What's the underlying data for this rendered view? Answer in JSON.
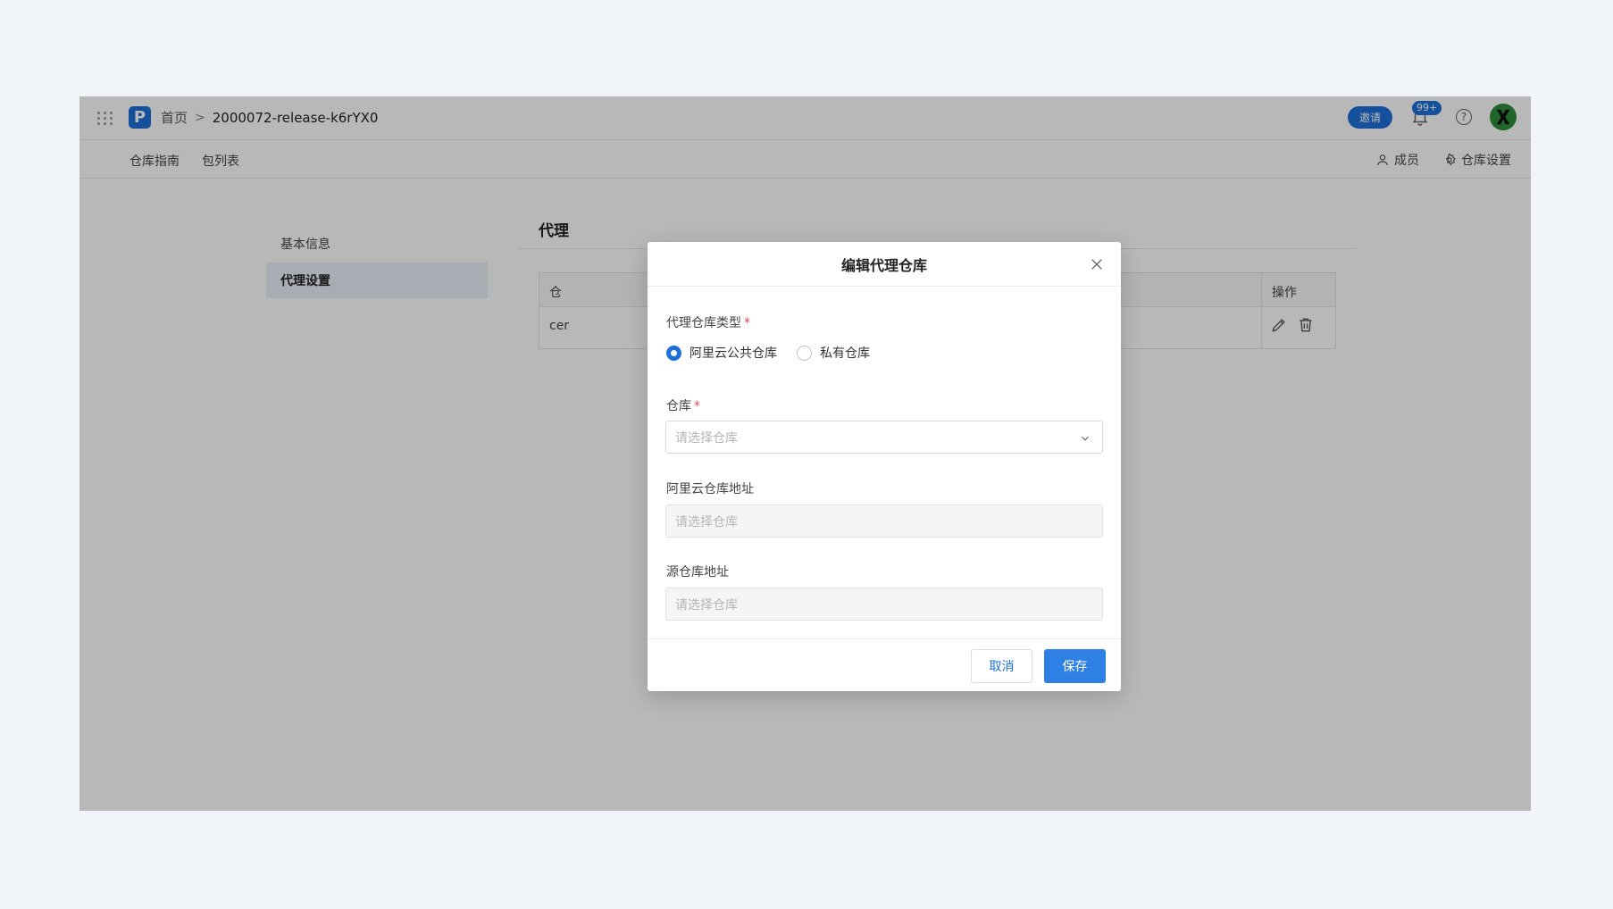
{
  "topbar": {
    "logo_letter": "P",
    "breadcrumb": {
      "home": "首页",
      "separator": ">",
      "current": "2000072-release-k6rYX0"
    },
    "invite_label": "邀请",
    "notification_count": "99+",
    "help_symbol": "?"
  },
  "subnav": {
    "tabs": [
      "仓库指南",
      "包列表"
    ],
    "members_label": "成员",
    "settings_label": "仓库设置"
  },
  "settings_menu": {
    "items": [
      "基本信息",
      "代理设置"
    ],
    "active_index": 1
  },
  "content": {
    "title": "代理",
    "table": {
      "header_first": "仓",
      "header_action": "操作",
      "row_first": "cer"
    }
  },
  "modal": {
    "title": "编辑代理仓库",
    "type_label": "代理仓库类型",
    "required_mark": "*",
    "type_options": [
      "阿里云公共仓库",
      "私有仓库"
    ],
    "type_selected_index": 0,
    "repo_label": "仓库",
    "repo_placeholder": "请选择仓库",
    "aliyun_addr_label": "阿里云仓库地址",
    "aliyun_addr_placeholder": "请选择仓库",
    "source_addr_label": "源仓库地址",
    "source_addr_placeholder": "请选择仓库",
    "cancel_label": "取消",
    "save_label": "保存"
  },
  "colors": {
    "accent": "#1e6fd9",
    "save_button": "#2f80e5",
    "required": "#e5484d",
    "page_background": "#f1f5f9"
  },
  "icons": [
    "grid-icon",
    "logo-icon",
    "bell-icon",
    "help-icon",
    "avatar",
    "user-icon",
    "gear-icon",
    "edit-icon",
    "trash-icon",
    "close-icon",
    "chevron-down-icon"
  ]
}
